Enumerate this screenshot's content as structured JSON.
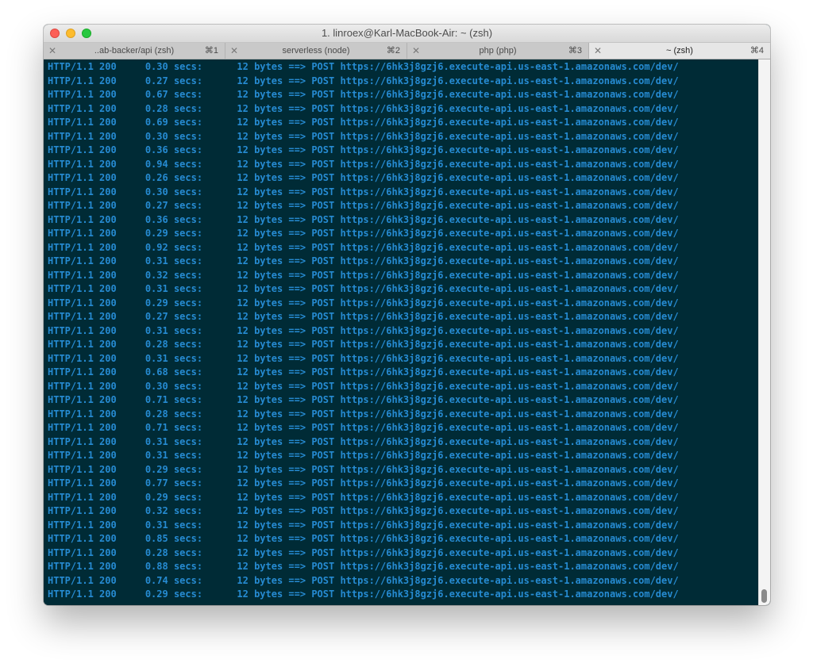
{
  "window": {
    "title": "1. linroex@Karl-MacBook-Air: ~ (zsh)"
  },
  "tabs": [
    {
      "label": "..ab-backer/api (zsh)",
      "shortcut": "⌘1",
      "active": false
    },
    {
      "label": "serverless (node)",
      "shortcut": "⌘2",
      "active": false
    },
    {
      "label": "php (php)",
      "shortcut": "⌘3",
      "active": false
    },
    {
      "label": "~ (zsh)",
      "shortcut": "⌘4",
      "active": true
    }
  ],
  "terminal": {
    "text_color": "#268bd2",
    "background_color": "#002b36",
    "lines": [
      "HTTP/1.1 200     0.30 secs:      12 bytes ==> POST https://6hk3j8gzj6.execute-api.us-east-1.amazonaws.com/dev/",
      "HTTP/1.1 200     0.27 secs:      12 bytes ==> POST https://6hk3j8gzj6.execute-api.us-east-1.amazonaws.com/dev/",
      "HTTP/1.1 200     0.67 secs:      12 bytes ==> POST https://6hk3j8gzj6.execute-api.us-east-1.amazonaws.com/dev/",
      "HTTP/1.1 200     0.28 secs:      12 bytes ==> POST https://6hk3j8gzj6.execute-api.us-east-1.amazonaws.com/dev/",
      "HTTP/1.1 200     0.69 secs:      12 bytes ==> POST https://6hk3j8gzj6.execute-api.us-east-1.amazonaws.com/dev/",
      "HTTP/1.1 200     0.30 secs:      12 bytes ==> POST https://6hk3j8gzj6.execute-api.us-east-1.amazonaws.com/dev/",
      "HTTP/1.1 200     0.36 secs:      12 bytes ==> POST https://6hk3j8gzj6.execute-api.us-east-1.amazonaws.com/dev/",
      "HTTP/1.1 200     0.94 secs:      12 bytes ==> POST https://6hk3j8gzj6.execute-api.us-east-1.amazonaws.com/dev/",
      "HTTP/1.1 200     0.26 secs:      12 bytes ==> POST https://6hk3j8gzj6.execute-api.us-east-1.amazonaws.com/dev/",
      "HTTP/1.1 200     0.30 secs:      12 bytes ==> POST https://6hk3j8gzj6.execute-api.us-east-1.amazonaws.com/dev/",
      "HTTP/1.1 200     0.27 secs:      12 bytes ==> POST https://6hk3j8gzj6.execute-api.us-east-1.amazonaws.com/dev/",
      "HTTP/1.1 200     0.36 secs:      12 bytes ==> POST https://6hk3j8gzj6.execute-api.us-east-1.amazonaws.com/dev/",
      "HTTP/1.1 200     0.29 secs:      12 bytes ==> POST https://6hk3j8gzj6.execute-api.us-east-1.amazonaws.com/dev/",
      "HTTP/1.1 200     0.92 secs:      12 bytes ==> POST https://6hk3j8gzj6.execute-api.us-east-1.amazonaws.com/dev/",
      "HTTP/1.1 200     0.31 secs:      12 bytes ==> POST https://6hk3j8gzj6.execute-api.us-east-1.amazonaws.com/dev/",
      "HTTP/1.1 200     0.32 secs:      12 bytes ==> POST https://6hk3j8gzj6.execute-api.us-east-1.amazonaws.com/dev/",
      "HTTP/1.1 200     0.31 secs:      12 bytes ==> POST https://6hk3j8gzj6.execute-api.us-east-1.amazonaws.com/dev/",
      "HTTP/1.1 200     0.29 secs:      12 bytes ==> POST https://6hk3j8gzj6.execute-api.us-east-1.amazonaws.com/dev/",
      "HTTP/1.1 200     0.27 secs:      12 bytes ==> POST https://6hk3j8gzj6.execute-api.us-east-1.amazonaws.com/dev/",
      "HTTP/1.1 200     0.31 secs:      12 bytes ==> POST https://6hk3j8gzj6.execute-api.us-east-1.amazonaws.com/dev/",
      "HTTP/1.1 200     0.28 secs:      12 bytes ==> POST https://6hk3j8gzj6.execute-api.us-east-1.amazonaws.com/dev/",
      "HTTP/1.1 200     0.31 secs:      12 bytes ==> POST https://6hk3j8gzj6.execute-api.us-east-1.amazonaws.com/dev/",
      "HTTP/1.1 200     0.68 secs:      12 bytes ==> POST https://6hk3j8gzj6.execute-api.us-east-1.amazonaws.com/dev/",
      "HTTP/1.1 200     0.30 secs:      12 bytes ==> POST https://6hk3j8gzj6.execute-api.us-east-1.amazonaws.com/dev/",
      "HTTP/1.1 200     0.71 secs:      12 bytes ==> POST https://6hk3j8gzj6.execute-api.us-east-1.amazonaws.com/dev/",
      "HTTP/1.1 200     0.28 secs:      12 bytes ==> POST https://6hk3j8gzj6.execute-api.us-east-1.amazonaws.com/dev/",
      "HTTP/1.1 200     0.71 secs:      12 bytes ==> POST https://6hk3j8gzj6.execute-api.us-east-1.amazonaws.com/dev/",
      "HTTP/1.1 200     0.31 secs:      12 bytes ==> POST https://6hk3j8gzj6.execute-api.us-east-1.amazonaws.com/dev/",
      "HTTP/1.1 200     0.31 secs:      12 bytes ==> POST https://6hk3j8gzj6.execute-api.us-east-1.amazonaws.com/dev/",
      "HTTP/1.1 200     0.29 secs:      12 bytes ==> POST https://6hk3j8gzj6.execute-api.us-east-1.amazonaws.com/dev/",
      "HTTP/1.1 200     0.77 secs:      12 bytes ==> POST https://6hk3j8gzj6.execute-api.us-east-1.amazonaws.com/dev/",
      "HTTP/1.1 200     0.29 secs:      12 bytes ==> POST https://6hk3j8gzj6.execute-api.us-east-1.amazonaws.com/dev/",
      "HTTP/1.1 200     0.32 secs:      12 bytes ==> POST https://6hk3j8gzj6.execute-api.us-east-1.amazonaws.com/dev/",
      "HTTP/1.1 200     0.31 secs:      12 bytes ==> POST https://6hk3j8gzj6.execute-api.us-east-1.amazonaws.com/dev/",
      "HTTP/1.1 200     0.85 secs:      12 bytes ==> POST https://6hk3j8gzj6.execute-api.us-east-1.amazonaws.com/dev/",
      "HTTP/1.1 200     0.28 secs:      12 bytes ==> POST https://6hk3j8gzj6.execute-api.us-east-1.amazonaws.com/dev/",
      "HTTP/1.1 200     0.88 secs:      12 bytes ==> POST https://6hk3j8gzj6.execute-api.us-east-1.amazonaws.com/dev/",
      "HTTP/1.1 200     0.74 secs:      12 bytes ==> POST https://6hk3j8gzj6.execute-api.us-east-1.amazonaws.com/dev/",
      "HTTP/1.1 200     0.29 secs:      12 bytes ==> POST https://6hk3j8gzj6.execute-api.us-east-1.amazonaws.com/dev/"
    ]
  }
}
